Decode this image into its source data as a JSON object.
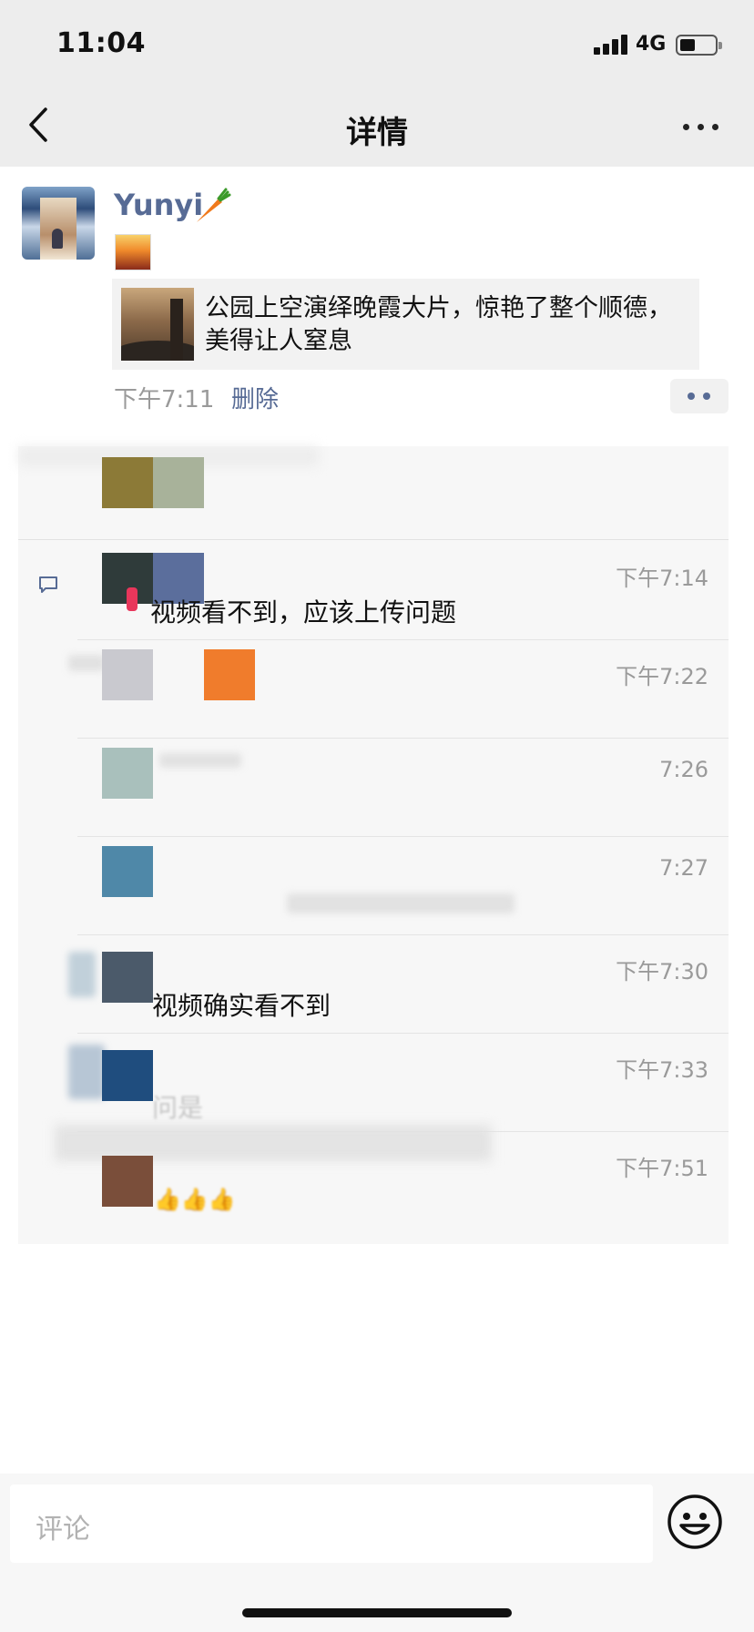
{
  "status_bar": {
    "time": "11:04",
    "network": "4G"
  },
  "nav": {
    "title": "详情"
  },
  "post": {
    "user_name": "Yunyi",
    "link_title": "公园上空演绎晚霞大片，惊艳了整个顺德，美得让人窒息",
    "time": "下午7:11",
    "delete_label": "删除"
  },
  "comments": [
    {
      "time": "下午7:14",
      "text": "视频看不到，应该上传问题",
      "avatar_color": "#2f3b3a",
      "faded": false
    },
    {
      "time": "下午7:22",
      "text": "",
      "avatar_color": "#c9c9cf",
      "faded": false
    },
    {
      "time": "7:26",
      "text": "",
      "avatar_color": "#a9c0bc",
      "faded": false
    },
    {
      "time": "7:27",
      "text": "",
      "avatar_color": "#4f88a8",
      "faded": true
    },
    {
      "time": "下午7:30",
      "text": "视频确实看不到",
      "avatar_color": "#4b5a6a",
      "faded": false
    },
    {
      "time": "下午7:33",
      "text": "问是",
      "avatar_color": "#1f4d7e",
      "faded": true
    },
    {
      "time": "下午7:51",
      "text": "👍👍👍",
      "avatar_color": "#7a4e3a",
      "faded": true
    }
  ],
  "likes": {
    "avatar_colors": [
      "#8c7a37",
      "#a8b29a"
    ]
  },
  "comment_input": {
    "placeholder": "评论"
  },
  "colors": {
    "link_blue": "#576b95",
    "panel_bg": "#f7f7f7",
    "nav_bg": "#ededed"
  },
  "icons": [
    "back-icon",
    "more-icon",
    "carrot-emoji",
    "comment-icon",
    "emoji-icon"
  ]
}
